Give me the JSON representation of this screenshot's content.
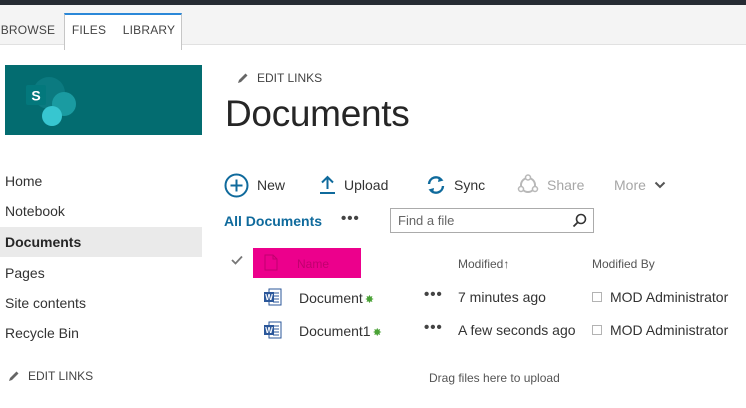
{
  "ribbon": {
    "tabs": [
      {
        "label": "BROWSE"
      },
      {
        "label": "FILES"
      },
      {
        "label": "LIBRARY"
      }
    ]
  },
  "colors": {
    "logo_bg": "#036c70",
    "accent_link": "#0f6a9c",
    "selected_nav_bg": "#eaeaea",
    "name_header_highlight": "#ec008c",
    "new_marker": "#4aa236"
  },
  "header": {
    "edit_links": "EDIT LINKS",
    "title": "Documents"
  },
  "nav": {
    "items": [
      {
        "label": "Home"
      },
      {
        "label": "Notebook"
      },
      {
        "label": "Documents",
        "selected": true
      },
      {
        "label": "Pages"
      },
      {
        "label": "Site contents"
      },
      {
        "label": "Recycle Bin"
      }
    ],
    "edit_links": "EDIT LINKS"
  },
  "commands": {
    "new": {
      "label": "New",
      "icon": "plus-circle-icon"
    },
    "upload": {
      "label": "Upload",
      "icon": "upload-arrow-icon"
    },
    "sync": {
      "label": "Sync",
      "icon": "sync-icon"
    },
    "share": {
      "label": "Share",
      "icon": "share-icon",
      "enabled": false
    },
    "more": {
      "label": "More",
      "icon": "chevron-down-icon",
      "enabled": false
    }
  },
  "view": {
    "current": "All Documents",
    "ellipsis": "•••"
  },
  "search": {
    "placeholder": "Find a file",
    "value": ""
  },
  "list": {
    "columns": {
      "name": "Name",
      "modified": "Modified",
      "modified_sort_arrow": "↑",
      "modified_by": "Modified By"
    },
    "rows": [
      {
        "name": "Document",
        "new_marker": "✸",
        "modified": "7 minutes ago",
        "modified_by": "MOD Administrator",
        "icon": "word-doc-icon"
      },
      {
        "name": "Document1",
        "new_marker": "✸",
        "modified": "A few seconds ago",
        "modified_by": "MOD Administrator",
        "icon": "word-doc-icon"
      }
    ],
    "row_menu": "•••",
    "drag_hint": "Drag files here to upload"
  }
}
